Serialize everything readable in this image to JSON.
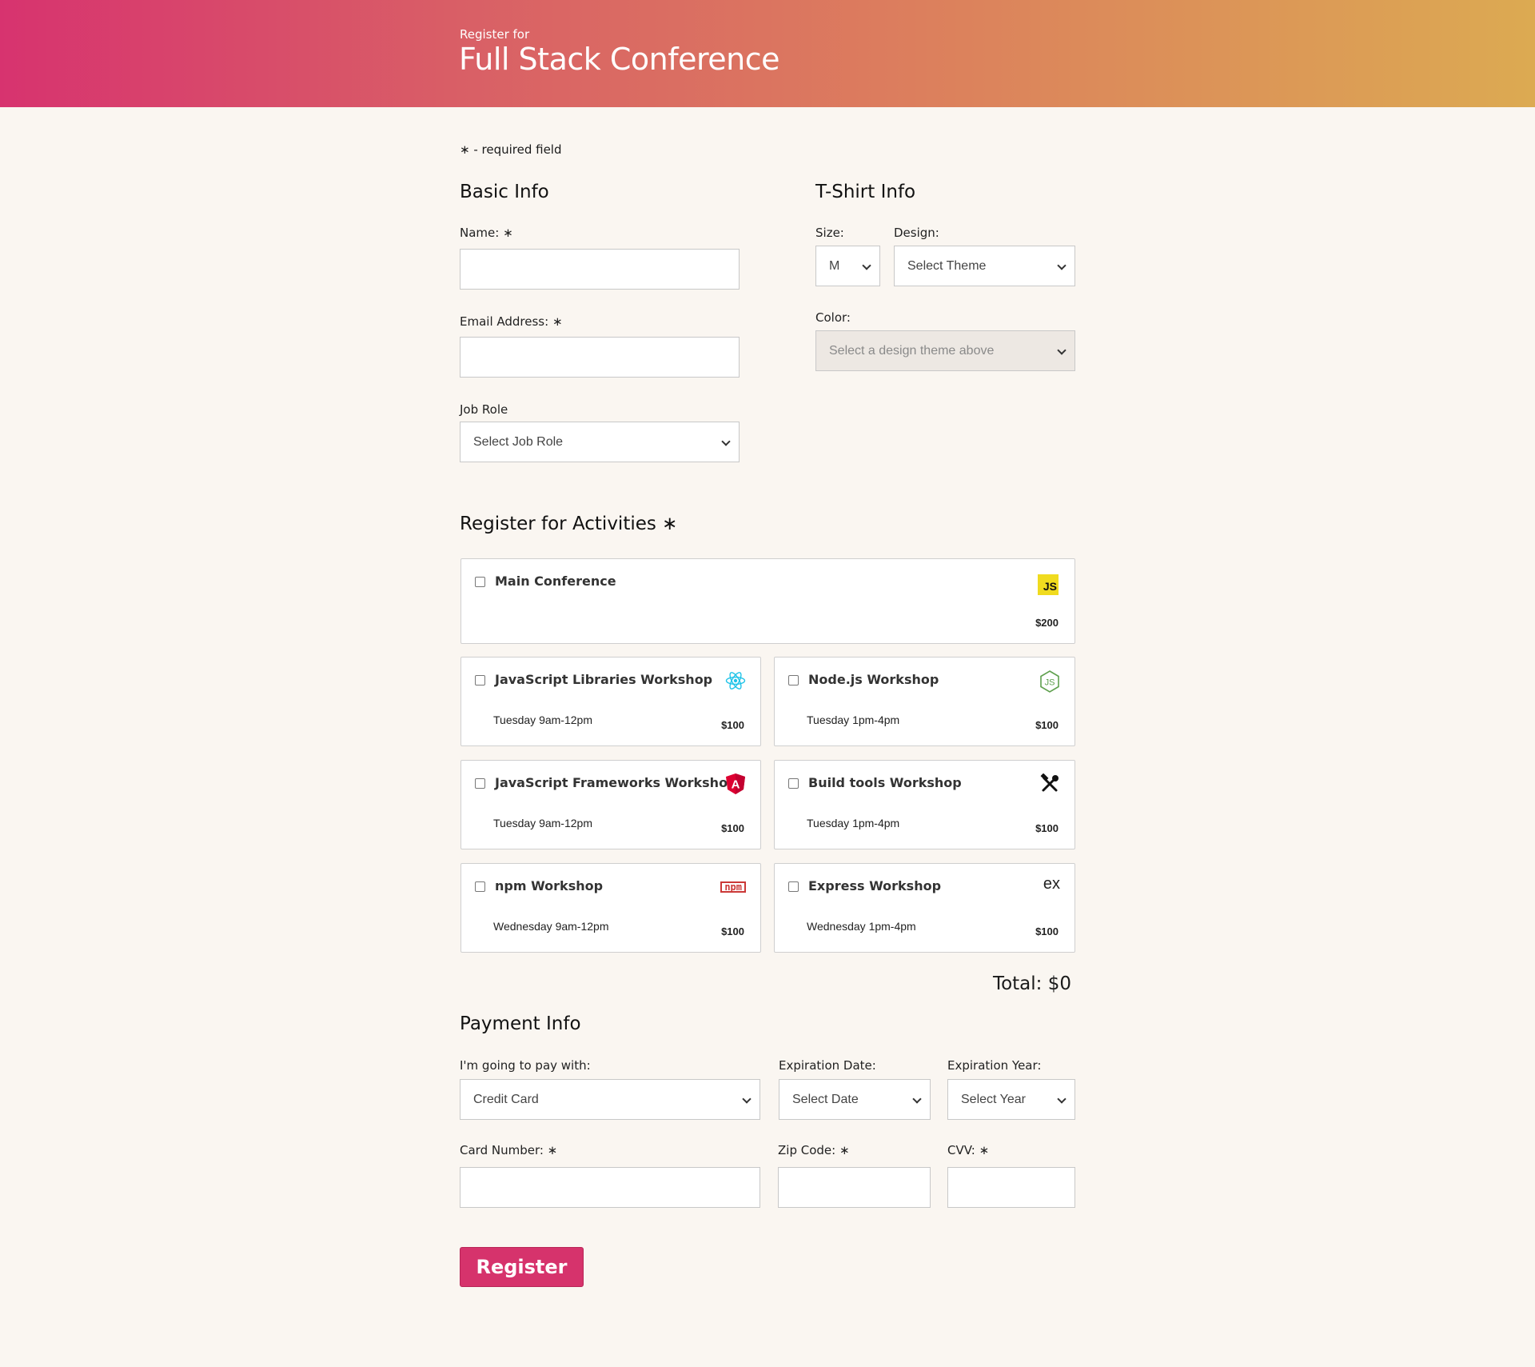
{
  "header": {
    "subtitle": "Register for",
    "title": "Full Stack Conference"
  },
  "required_note": "∗ - required field",
  "basic_info": {
    "heading": "Basic Info",
    "name_label": "Name: ∗",
    "email_label": "Email Address: ∗",
    "job_role_label": "Job Role",
    "job_role_value": "Select Job Role"
  },
  "tshirt": {
    "heading": "T-Shirt Info",
    "size_label": "Size:",
    "size_value": "M",
    "design_label": "Design:",
    "design_value": "Select Theme",
    "color_label": "Color:",
    "color_value": "Select a design theme above"
  },
  "activities": {
    "heading": "Register for Activities ∗",
    "items": [
      {
        "name": "Main Conference",
        "time": "",
        "price": "$200",
        "icon": "javascript-icon"
      },
      {
        "name": "JavaScript Libraries Workshop",
        "time": "Tuesday 9am-12pm",
        "price": "$100",
        "icon": "react-icon"
      },
      {
        "name": "Node.js Workshop",
        "time": "Tuesday 1pm-4pm",
        "price": "$100",
        "icon": "nodejs-icon"
      },
      {
        "name": "JavaScript Frameworks Workshop",
        "time": "Tuesday 9am-12pm",
        "price": "$100",
        "icon": "angular-icon"
      },
      {
        "name": "Build tools Workshop",
        "time": "Tuesday 1pm-4pm",
        "price": "$100",
        "icon": "tools-icon"
      },
      {
        "name": "npm Workshop",
        "time": "Wednesday 9am-12pm",
        "price": "$100",
        "icon": "npm-icon"
      },
      {
        "name": "Express Workshop",
        "time": "Wednesday 1pm-4pm",
        "price": "$100",
        "icon": "express-icon"
      }
    ],
    "icon_texts": {
      "js": "JS",
      "npm": "npm",
      "express": "ex"
    },
    "total": "Total: $0"
  },
  "payment": {
    "heading": "Payment Info",
    "pay_with_label": "I'm going to pay with:",
    "pay_with_value": "Credit Card",
    "exp_date_label": "Expiration Date:",
    "exp_date_value": "Select Date",
    "exp_year_label": "Expiration Year:",
    "exp_year_value": "Select Year",
    "card_number_label": "Card Number: ∗",
    "zip_label": "Zip Code: ∗",
    "cvv_label": "CVV: ∗"
  },
  "register_button": "Register",
  "colors": {
    "accent": "#d6336c",
    "gradient_start": "#d7336f",
    "gradient_end": "#dcaa52",
    "background": "#faf6f1"
  }
}
